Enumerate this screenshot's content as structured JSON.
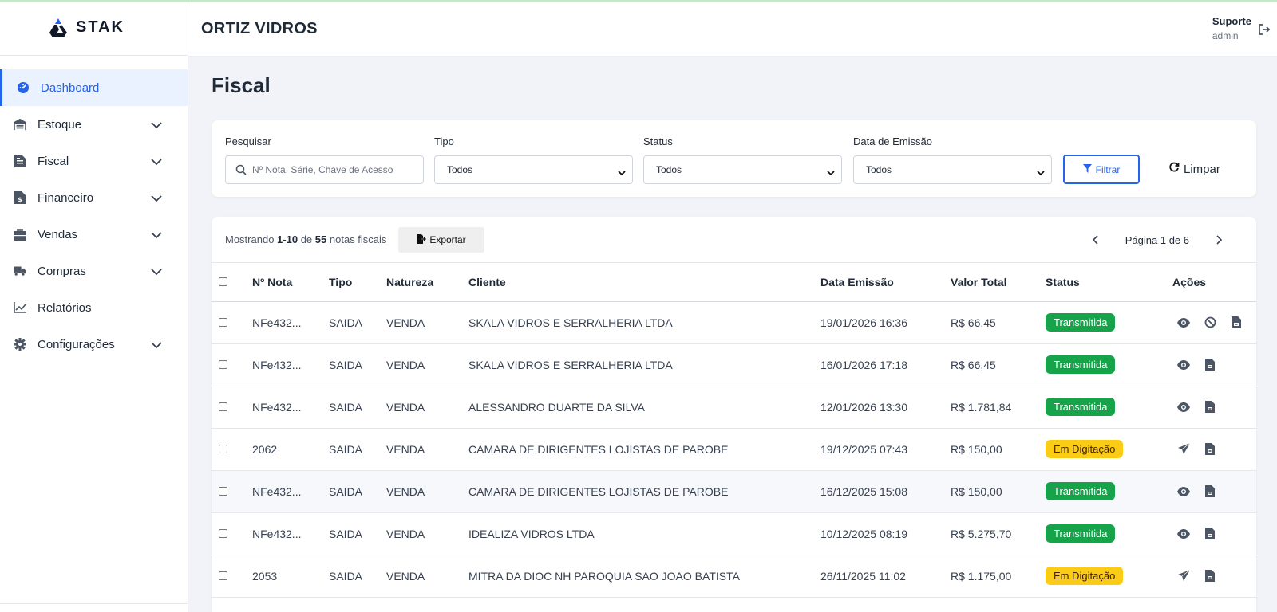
{
  "brand": {
    "name": "STAK"
  },
  "header": {
    "company": "ORTIZ VIDROS",
    "user_name": "Suporte",
    "user_role": "admin"
  },
  "sidebar": {
    "items": [
      {
        "label": "Dashboard",
        "icon": "gauge-icon",
        "active": true,
        "expandable": false
      },
      {
        "label": "Estoque",
        "icon": "warehouse-icon",
        "expandable": true
      },
      {
        "label": "Fiscal",
        "icon": "document-icon",
        "expandable": true
      },
      {
        "label": "Financeiro",
        "icon": "invoice-dollar-icon",
        "expandable": true
      },
      {
        "label": "Vendas",
        "icon": "briefcase-icon",
        "expandable": true
      },
      {
        "label": "Compras",
        "icon": "truck-icon",
        "expandable": true
      },
      {
        "label": "Relatórios",
        "icon": "chart-line-icon",
        "expandable": false
      },
      {
        "label": "Configurações",
        "icon": "gear-icon",
        "expandable": true
      }
    ]
  },
  "page": {
    "title": "Fiscal"
  },
  "filters": {
    "search_label": "Pesquisar",
    "search_placeholder": "Nº Nota, Série, Chave de Acesso",
    "tipo_label": "Tipo",
    "tipo_value": "Todos",
    "status_label": "Status",
    "status_value": "Todos",
    "data_label": "Data de Emissão",
    "data_value": "Todos",
    "filter_button": "Filtrar",
    "clear_button": "Limpar"
  },
  "table_meta": {
    "showing_prefix": "Mostrando",
    "range": "1-10",
    "of": "de",
    "total": "55",
    "suffix": "notas fiscais",
    "export_button": "Exportar",
    "page_text": "Página 1 de 6"
  },
  "columns": [
    "Nº Nota",
    "Tipo",
    "Natureza",
    "Cliente",
    "Data Emissão",
    "Valor Total",
    "Status",
    "Ações"
  ],
  "rows": [
    {
      "nota": "NFe432...",
      "tipo": "SAIDA",
      "natureza": "VENDA",
      "cliente": "SKALA VIDROS E SERRALHERIA LTDA",
      "data": "19/01/2026 16:36",
      "valor": "R$ 66,45",
      "status": "Transmitida",
      "status_kind": "ok",
      "actions": [
        "eye-icon",
        "ban-icon",
        "file-icon"
      ]
    },
    {
      "nota": "NFe432...",
      "tipo": "SAIDA",
      "natureza": "VENDA",
      "cliente": "SKALA VIDROS E SERRALHERIA LTDA",
      "data": "16/01/2026 17:18",
      "valor": "R$ 66,45",
      "status": "Transmitida",
      "status_kind": "ok",
      "actions": [
        "eye-icon",
        "file-icon"
      ]
    },
    {
      "nota": "NFe432...",
      "tipo": "SAIDA",
      "natureza": "VENDA",
      "cliente": "ALESSANDRO DUARTE DA SILVA",
      "data": "12/01/2026 13:30",
      "valor": "R$ 1.781,84",
      "status": "Transmitida",
      "status_kind": "ok",
      "actions": [
        "eye-icon",
        "file-icon"
      ]
    },
    {
      "nota": "2062",
      "tipo": "SAIDA",
      "natureza": "VENDA",
      "cliente": "CAMARA DE DIRIGENTES LOJISTAS DE PAROBE",
      "data": "19/12/2025 07:43",
      "valor": "R$ 150,00",
      "status": "Em Digitação",
      "status_kind": "wip",
      "actions": [
        "send-icon",
        "file-icon"
      ]
    },
    {
      "nota": "NFe432...",
      "tipo": "SAIDA",
      "natureza": "VENDA",
      "cliente": "CAMARA DE DIRIGENTES LOJISTAS DE PAROBE",
      "data": "16/12/2025 15:08",
      "valor": "R$ 150,00",
      "status": "Transmitida",
      "status_kind": "ok",
      "actions": [
        "eye-icon",
        "file-icon"
      ],
      "highlight": true
    },
    {
      "nota": "NFe432...",
      "tipo": "SAIDA",
      "natureza": "VENDA",
      "cliente": "IDEALIZA VIDROS LTDA",
      "data": "10/12/2025 08:19",
      "valor": "R$ 5.275,70",
      "status": "Transmitida",
      "status_kind": "ok",
      "actions": [
        "eye-icon",
        "file-icon"
      ]
    },
    {
      "nota": "2053",
      "tipo": "SAIDA",
      "natureza": "VENDA",
      "cliente": "MITRA DA DIOC NH PAROQUIA SAO JOAO BATISTA",
      "data": "26/11/2025 11:02",
      "valor": "R$ 1.175,00",
      "status": "Em Digitação",
      "status_kind": "wip",
      "actions": [
        "send-icon",
        "file-icon"
      ]
    },
    {
      "nota": "",
      "tipo": "",
      "natureza": "",
      "cliente": "",
      "data": "",
      "valor": "",
      "status": "",
      "status_kind": "ok",
      "actions": []
    }
  ],
  "colors": {
    "accent": "#2563eb",
    "success": "#16a34a",
    "warning": "#facc15",
    "icon": "#4b5563"
  }
}
